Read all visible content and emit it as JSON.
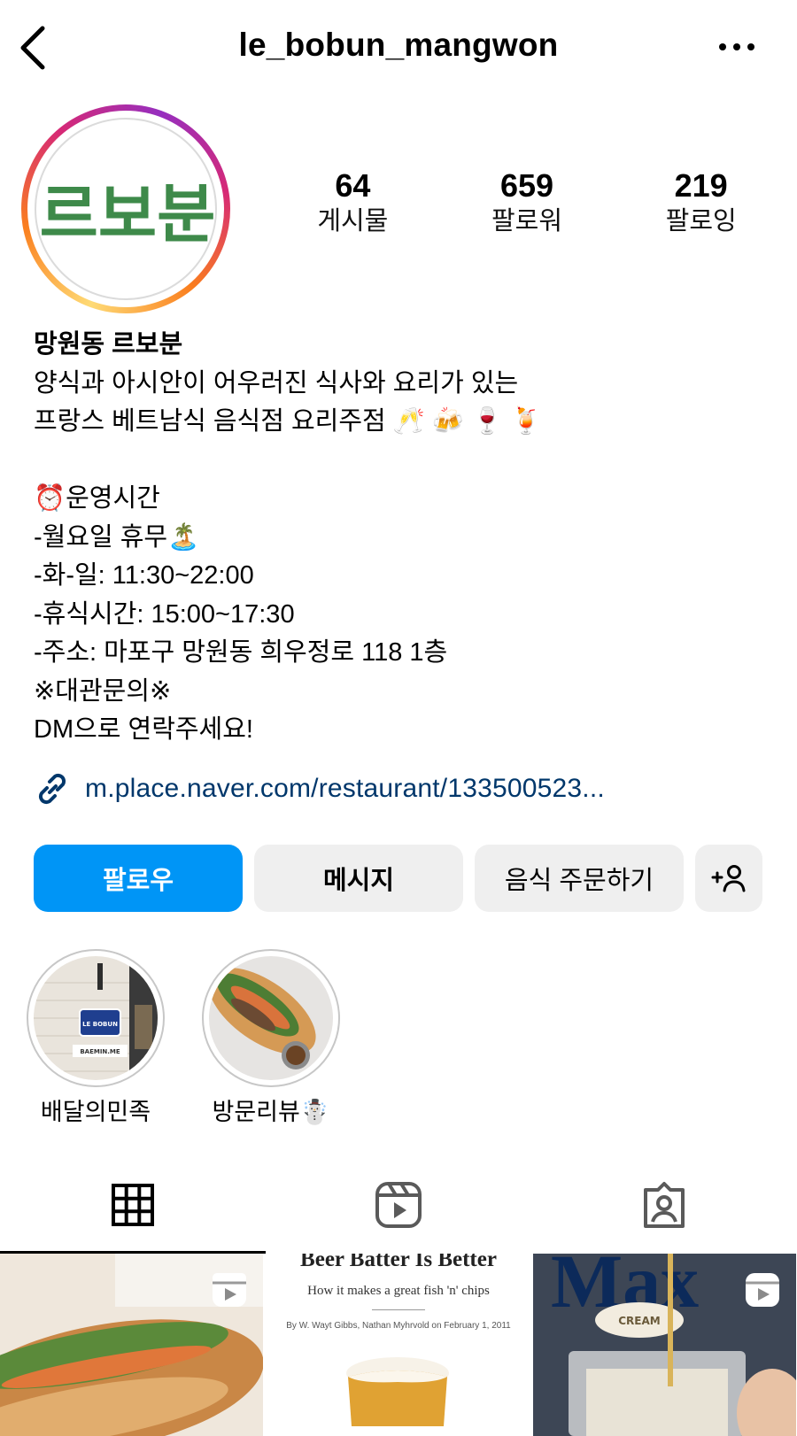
{
  "header": {
    "username": "le_bobun_mangwon"
  },
  "avatar": {
    "logo_text": "르보분"
  },
  "stats": [
    {
      "value": "64",
      "label": "게시물"
    },
    {
      "value": "659",
      "label": "팔로워"
    },
    {
      "value": "219",
      "label": "팔로잉"
    }
  ],
  "bio": {
    "name": "망원동 르보분",
    "lines": [
      "양식과 아시안이 어우러진 식사와 요리가 있는",
      "프랑스 베트남식 음식점 요리주점 🥂 🍻 🍷 🍹",
      "",
      "⏰운영시간",
      "-월요일 휴무🏝️",
      "-화-일: 11:30~22:00",
      "-휴식시간: 15:00~17:30",
      "-주소: 마포구 망원동 희우정로 118 1층",
      "※대관문의※",
      "DM으로 연락주세요!"
    ],
    "link": "m.place.naver.com/restaurant/133500523..."
  },
  "buttons": {
    "follow": "팔로우",
    "message": "메시지",
    "order": "음식 주문하기",
    "add_user": "+person-icon"
  },
  "highlights": [
    {
      "label": "배달의민족",
      "sign_text": "LE BOBUN",
      "banner_text": "BAEMIN.ME"
    },
    {
      "label": "방문리뷰☃️"
    }
  ],
  "tabs": [
    "grid-icon",
    "reels-icon",
    "tagged-icon"
  ],
  "grid": {
    "article_title": "Beer Batter Is Better",
    "article_subtitle": "How it makes a great fish 'n' chips",
    "article_byline": "By W. Wayt Gibbs, Nathan Myhrvold on February 1, 2011",
    "can_text": "Max",
    "cream_text": "CREAM"
  },
  "colors": {
    "follow_blue": "#0095f6",
    "link_blue": "#00376b",
    "logo_green": "#3e8a4a",
    "button_gray": "#efefef"
  }
}
